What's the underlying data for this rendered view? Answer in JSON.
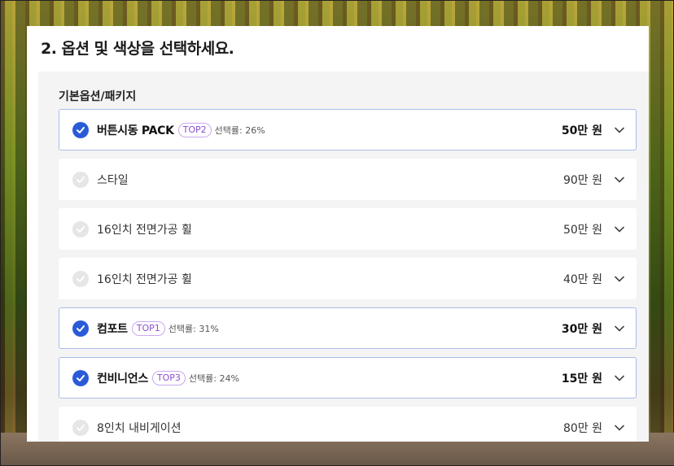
{
  "section": {
    "title": "2. 옵션 및 색상을 선택하세요."
  },
  "group": {
    "label": "기본옵션/패키지"
  },
  "options": [
    {
      "name": "버튼시동 PACK",
      "badge": "TOP2",
      "rate": "선택률: 26%",
      "price": "50만 원",
      "selected": true
    },
    {
      "name": "스타일",
      "price": "90만 원",
      "selected": false
    },
    {
      "name": "16인치 전면가공 휠",
      "price": "50만 원",
      "selected": false
    },
    {
      "name": "16인치 전면가공 휠",
      "price": "40만 원",
      "selected": false
    },
    {
      "name": "컴포트",
      "badge": "TOP1",
      "rate": "선택률: 31%",
      "price": "30만 원",
      "selected": true
    },
    {
      "name": "컨비니언스",
      "badge": "TOP3",
      "rate": "선택률: 24%",
      "price": "15만 원",
      "selected": true
    },
    {
      "name": "8인치 내비게이션",
      "price": "80만 원",
      "selected": false
    }
  ],
  "colors": {
    "accent": "#2a5bd7",
    "selected_border": "#a9bde8",
    "badge_text": "#8a4fd0",
    "badge_border": "#c9a8ee",
    "unselected_check": "#e6e6e6"
  },
  "icons": {
    "check": "check-icon",
    "expand": "chevron-down-icon"
  }
}
